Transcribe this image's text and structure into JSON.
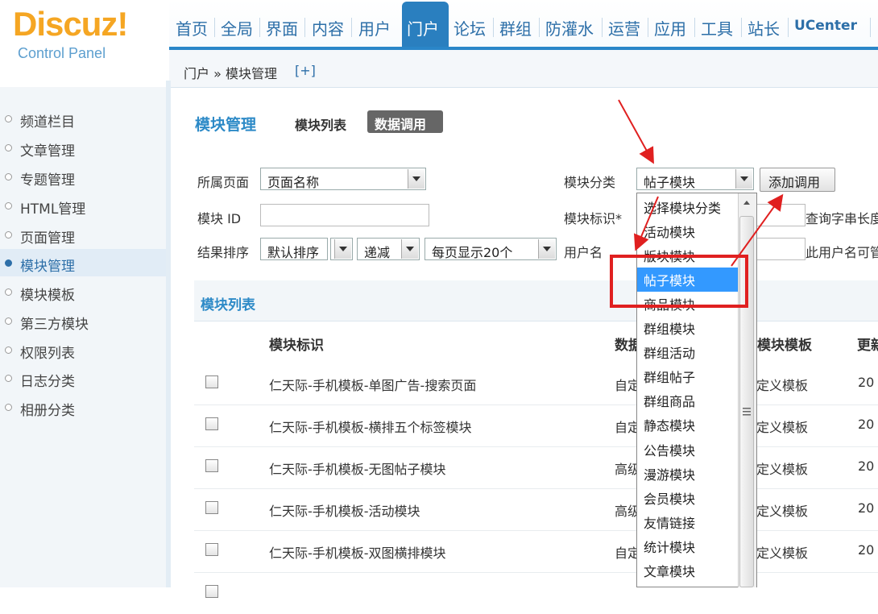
{
  "header": {
    "logo_title": "Discuz!",
    "logo_sub": "Control Panel",
    "nav": [
      "首页",
      "全局",
      "界面",
      "内容",
      "用户",
      "门户",
      "论坛",
      "群组",
      "防灌水",
      "运营",
      "应用",
      "工具",
      "站长",
      "UCenter"
    ],
    "active_nav": "门户"
  },
  "breadcrumb": {
    "text": "门户 » 模块管理",
    "add": "[+]"
  },
  "sidebar": {
    "items": [
      "频道栏目",
      "文章管理",
      "专题管理",
      "HTML管理",
      "页面管理",
      "模块管理",
      "模块模板",
      "第三方模块",
      "权限列表",
      "日志分类",
      "相册分类"
    ],
    "active": "模块管理"
  },
  "main": {
    "title": "模块管理",
    "tab_list": "模块列表",
    "tab_call": "数据调用"
  },
  "filters": {
    "page_label": "所属页面",
    "page_value": "页面名称",
    "category_label": "模块分类",
    "category_value": "帖子模块",
    "add_button": "添加调用",
    "id_label": "模块 ID",
    "id_value": "",
    "ident_label": "模块标识*",
    "ident_hint": "查询字串长度",
    "sort_label": "结果排序",
    "sort_value": "默认排序",
    "order_value": "递减",
    "perpage_value": "每页显示20个",
    "user_label": "用户名",
    "user_hint": "此用户名可管理"
  },
  "table": {
    "section_title": "模块列表",
    "headers": {
      "ident": "模块标识",
      "data": "数据",
      "template": "模块模板",
      "updated": "更新"
    },
    "rows": [
      {
        "name": "仁天际-手机模板-单图广告-搜索页面",
        "source": "自定",
        "template": "定义模板",
        "updated": "20"
      },
      {
        "name": "仁天际-手机模板-横排五个标签模块",
        "source": "自定",
        "template": "定义模板",
        "updated": "20"
      },
      {
        "name": "仁天际-手机模板-无图帖子模块",
        "source": "高级",
        "template": "定义模板",
        "updated": "20"
      },
      {
        "name": "仁天际-手机模板-活动模块",
        "source": "高级",
        "template": "定义模板",
        "updated": "20"
      },
      {
        "name": "仁天际-手机模板-双图横排模块",
        "source": "自定",
        "template": "定义模板",
        "updated": "20"
      }
    ]
  },
  "dropdown": {
    "items": [
      "选择模块分类",
      "活动模块",
      "版块模块",
      "帖子模块",
      "商品模块",
      "群组模块",
      "群组活动",
      "群组帖子",
      "群组商品",
      "静态模块",
      "公告模块",
      "漫游模块",
      "会员模块",
      "友情链接",
      "统计模块",
      "文章模块"
    ],
    "selected": "帖子模块"
  },
  "colors": {
    "accent": "#2a7fbf",
    "highlight": "#e02020",
    "selection": "#3399ff",
    "logo": "#f5a623"
  }
}
